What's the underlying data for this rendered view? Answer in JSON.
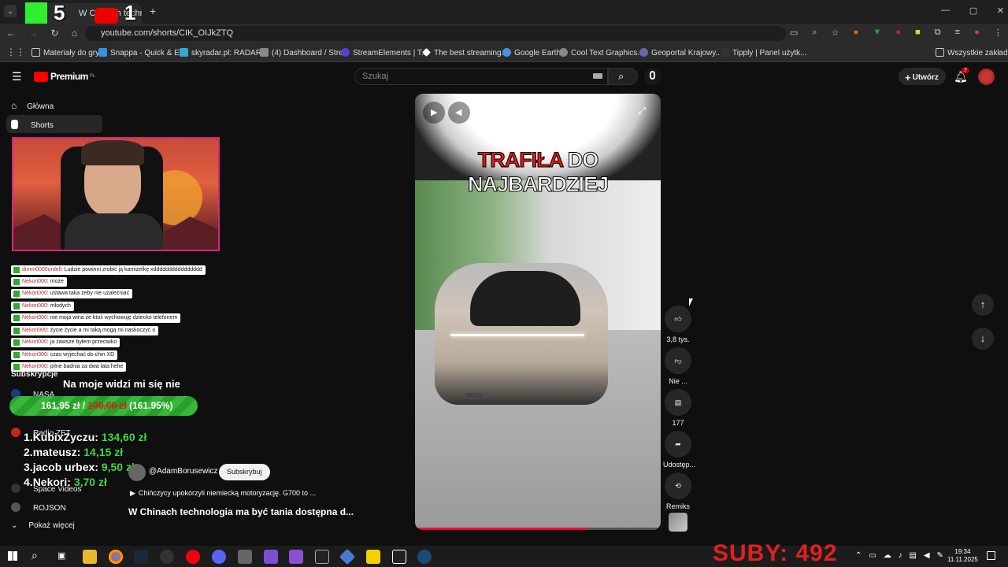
{
  "browser": {
    "tab_title": "W Chinach techno",
    "url": "youtube.com/shorts/CIK_OIJkZTQ",
    "bookmarks": [
      "Materiały do gry",
      "Snappa - Quick & E...",
      "skyradar.pl: RADAR...",
      "(4) Dashboard / Stre...",
      "StreamElements | T...",
      "The best streaming...",
      "Google Earth",
      "Cool Text Graphics...",
      "Geoportal Krajowy...",
      "Tipply | Panel użytk...",
      "Wszystkie zakładki"
    ]
  },
  "overlay": {
    "k_count": "5",
    "yt_count": "1"
  },
  "youtube": {
    "logo": "Premium",
    "logo_badge": "PL",
    "search_placeholder": "Szukaj",
    "create_label": "Utwórz",
    "notif_count": "7",
    "sidebar": [
      {
        "label": "Główna",
        "icon": "home-icon"
      },
      {
        "label": "Shorts",
        "icon": "shorts-icon"
      }
    ],
    "subscriptions_label": "Subskrypcje",
    "subscriptions": [
      "NASA",
      "Radio ZET",
      "Space Videos",
      "ROJSON"
    ],
    "show_more": "Pokaż więcej"
  },
  "chat": [
    {
      "user": "dimm0000ordell",
      "msg": ": Ludzie powinni zrobić ją kamizelkę xdddddddddddddddd"
    },
    {
      "user": "Nekori000",
      "msg": ": może"
    },
    {
      "user": "Nekori000",
      "msg": ": ustawa taka żeby nie uzależniać"
    },
    {
      "user": "Nekori000",
      "msg": ": młodych"
    },
    {
      "user": "Nekori000",
      "msg": ": nie moja wina że ktoś wychowuję dziecko telefonem"
    },
    {
      "user": "Nekori000",
      "msg": ": życie życie a mi taką mogą mi naskoczyć o"
    },
    {
      "user": "Nekori000",
      "msg": ": ja zawsze byłem przeciwko"
    },
    {
      "user": "Nekori000",
      "msg": ": czas wyjechać do chin XD"
    },
    {
      "user": "Nekori000",
      "msg": ": pilne badnia za dwa lata hehe"
    }
  ],
  "donation": {
    "title": "Na moje widzi mi się nie",
    "current": "161,95 zł /",
    "goal": "100,00 zł",
    "percent": "(161.95%)",
    "percent_value": 161.95,
    "leaderboard": [
      {
        "rank": "1.",
        "name": "KubixZyczu:",
        "amount": "134,60 zł"
      },
      {
        "rank": "2.",
        "name": "mateusz:",
        "amount": "14,15 zł"
      },
      {
        "rank": "3.",
        "name": "jacob urbex:",
        "amount": "9,50 zł"
      },
      {
        "rank": "4.",
        "name": "Nekori:",
        "amount": "3,70 zł"
      }
    ]
  },
  "video": {
    "overlay_text_red": "TRAFIŁA",
    "overlay_text_white": "DO NAJBARDZIEJ",
    "channel": "@AdamBorusewicz",
    "subscribe": "Subskrybuj",
    "description": "Chińczycy upokorzyli niemiecką motoryzację. G700 to ...",
    "title": "W Chinach technologia ma być tania dostępna d...",
    "car_badge": "MEGA",
    "actions": [
      {
        "icon": "like-icon",
        "label": "3,8 tys."
      },
      {
        "icon": "dislike-icon",
        "label": "Nie ..."
      },
      {
        "icon": "comment-icon",
        "label": "177"
      },
      {
        "icon": "share-icon",
        "label": "Udostęp..."
      },
      {
        "icon": "remix-icon",
        "label": "Remiks"
      }
    ]
  },
  "taskbar": {
    "time": "19:34",
    "date": "11.11.2025"
  },
  "stream": {
    "subs": "SUBY: 492"
  }
}
